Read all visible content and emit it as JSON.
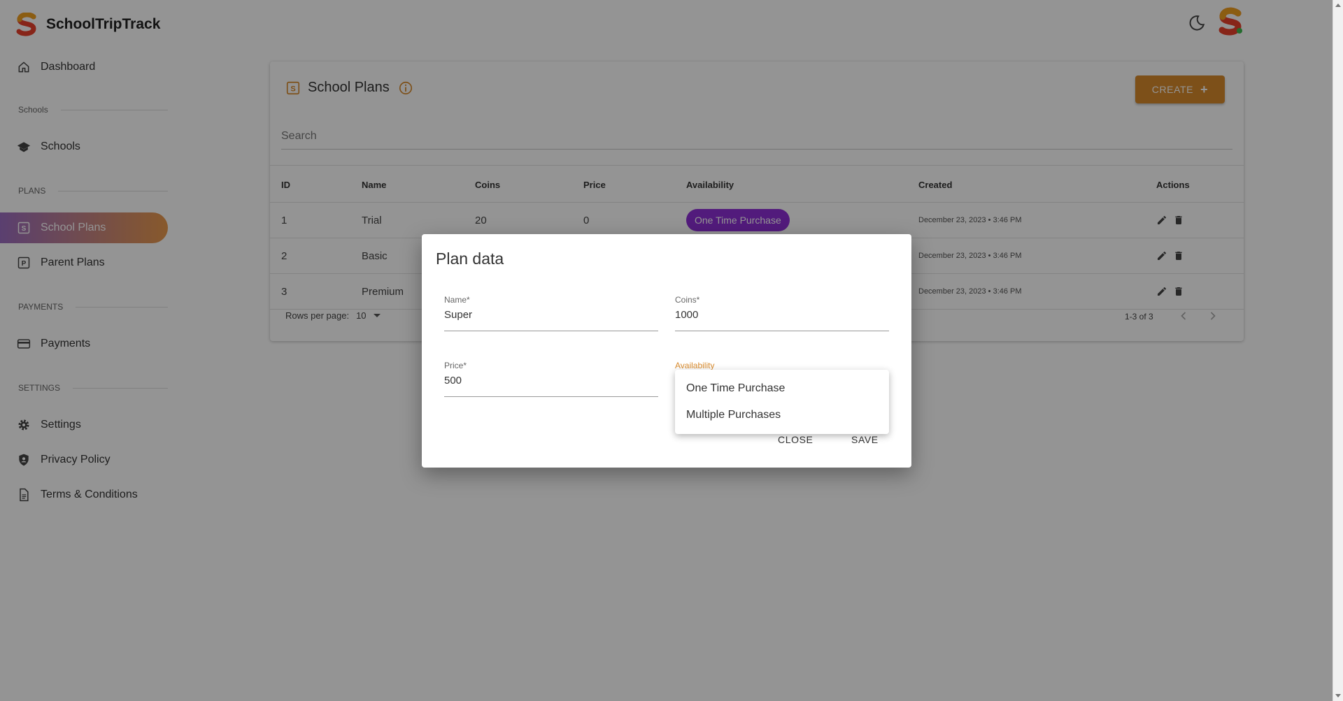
{
  "app": {
    "name": "SchoolTripTrack"
  },
  "sidebar": {
    "items": [
      {
        "label": "Dashboard",
        "icon": "home-icon"
      },
      {
        "label": "Schools",
        "icon": "school-icon"
      },
      {
        "label": "School Plans",
        "icon": "plan-s-icon",
        "active": true
      },
      {
        "label": "Parent Plans",
        "icon": "plan-p-icon"
      },
      {
        "label": "Payments",
        "icon": "credit-card-icon"
      },
      {
        "label": "Settings",
        "icon": "gear-icon"
      },
      {
        "label": "Privacy Policy",
        "icon": "shield-icon"
      },
      {
        "label": "Terms & Conditions",
        "icon": "document-icon"
      }
    ],
    "sections": [
      "Schools",
      "PLANS",
      "PAYMENTS",
      "SETTINGS"
    ]
  },
  "page": {
    "title": "School Plans",
    "create_label": "CREATE",
    "search_placeholder": "Search"
  },
  "table": {
    "headers": [
      "ID",
      "Name",
      "Coins",
      "Price",
      "Availability",
      "Created",
      "Actions"
    ],
    "rows": [
      {
        "id": "1",
        "name": "Trial",
        "coins": "20",
        "price": "0",
        "availability": "One Time Purchase",
        "created": "December 23, 2023 • 3:46 PM"
      },
      {
        "id": "2",
        "name": "Basic",
        "coins": "",
        "price": "",
        "availability": "",
        "created": "December 23, 2023 • 3:46 PM"
      },
      {
        "id": "3",
        "name": "Premium",
        "coins": "",
        "price": "",
        "availability": "",
        "created": "December 23, 2023 • 3:46 PM"
      }
    ],
    "rows_per_page_label": "Rows per page:",
    "rows_per_page_value": "10",
    "range_text": "1-3 of 3"
  },
  "dialog": {
    "title": "Plan data",
    "fields": {
      "name": {
        "label": "Name*",
        "value": "Super"
      },
      "coins": {
        "label": "Coins*",
        "value": "1000"
      },
      "price": {
        "label": "Price*",
        "value": "500"
      },
      "availability": {
        "label": "Availability"
      }
    },
    "menu_options": [
      "One Time Purchase",
      "Multiple Purchases"
    ],
    "close_label": "CLOSE",
    "save_label": "SAVE"
  },
  "colors": {
    "accent": "#d88a2c",
    "chip": "#8e2fd6",
    "active_gradient_start": "#9c6dc1",
    "active_gradient_end": "#ea9a4d"
  }
}
